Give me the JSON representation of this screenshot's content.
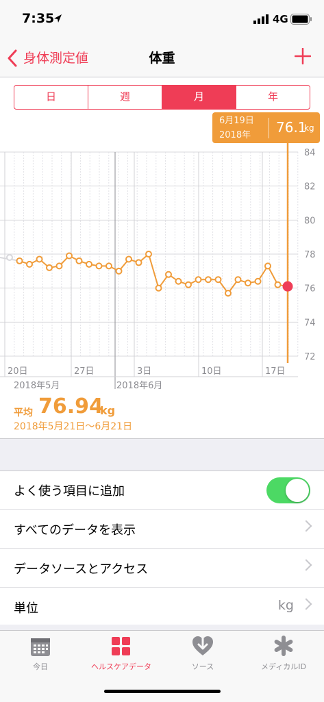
{
  "status": {
    "time": "7:35",
    "carrier": "4G"
  },
  "nav": {
    "back_label": "身体測定値",
    "title": "体重"
  },
  "segments": [
    {
      "label": "日",
      "active": false
    },
    {
      "label": "週",
      "active": false
    },
    {
      "label": "月",
      "active": true
    },
    {
      "label": "年",
      "active": false
    }
  ],
  "tooltip": {
    "date": "6月19日",
    "year": "2018年",
    "value": "76.1",
    "unit": "kg"
  },
  "chart_data": {
    "type": "line",
    "y_ticks": [
      "84",
      "82",
      "80",
      "78",
      "76",
      "74",
      "72"
    ],
    "ylim": [
      72,
      84
    ],
    "x_tick_labels": [
      "20日",
      "27日",
      "3日",
      "10日",
      "17日"
    ],
    "month_labels": [
      "2018年5月",
      "2018年6月"
    ],
    "series": [
      {
        "values": [
          77.8,
          77.6,
          77.4,
          77.7,
          77.2,
          77.3,
          77.9,
          77.6,
          77.4,
          77.3,
          77.3,
          77.0,
          77.7,
          77.5,
          78.0,
          76.0,
          76.8,
          76.4,
          76.2,
          76.5,
          76.5,
          76.5,
          75.7,
          76.5,
          76.3,
          76.4,
          77.3,
          76.2,
          76.1
        ]
      }
    ],
    "selected_index": 28,
    "line_color": "#f09c3a",
    "highlight_color": "#ef3d56"
  },
  "average": {
    "label": "平均",
    "value": "76.94",
    "unit": "kg",
    "range": "2018年5月21日〜6月21日"
  },
  "rows": {
    "favorite": "よく使う項目に追加",
    "all_data": "すべてのデータを表示",
    "sources": "データソースとアクセス",
    "unit_label": "単位",
    "unit_value": "kg"
  },
  "tabs": [
    {
      "label": "今日",
      "icon": "calendar-icon",
      "active": false
    },
    {
      "label": "ヘルスケアデータ",
      "icon": "grid-icon",
      "active": true
    },
    {
      "label": "ソース",
      "icon": "download-heart-icon",
      "active": false
    },
    {
      "label": "メディカルID",
      "icon": "asterisk-icon",
      "active": false
    }
  ],
  "colors": {
    "accent": "#ef3d56",
    "orange": "#f09c3a",
    "toggle": "#4cd964"
  }
}
